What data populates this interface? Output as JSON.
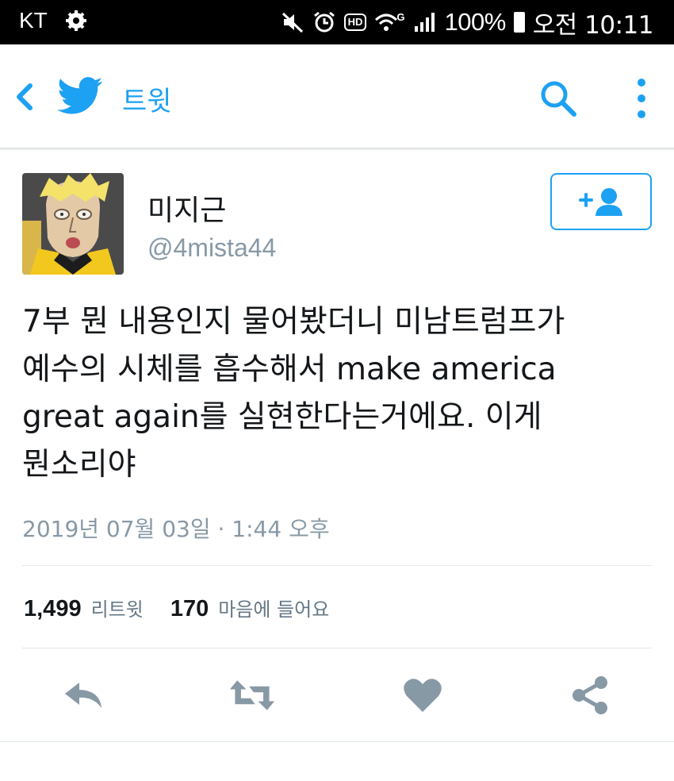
{
  "status_bar": {
    "carrier": "KT",
    "hd_label": "HD",
    "network_label": "G",
    "battery_percent": "100%",
    "time": "오전 10:11",
    "icons": [
      "gear-icon",
      "mute-icon",
      "alarm-icon",
      "wifi-icon",
      "signal-icon",
      "battery-icon"
    ]
  },
  "app_bar": {
    "title": "트윗",
    "icons": [
      "back-icon",
      "twitter-bird-icon",
      "search-icon",
      "more-vertical-icon"
    ]
  },
  "tweet": {
    "author": {
      "display_name": "미지근",
      "handle": "@4mista44"
    },
    "text": "7부 뭔 내용인지 물어봤더니 미남트럼프가\n예수의 시체를 흡수해서 make america\ngreat again를 실현한다는거에요. 이게\n뭔소리야",
    "timestamp": "2019년 07월 03일 · 1:44 오후",
    "retweets": {
      "count": "1,499",
      "label": "리트윗"
    },
    "likes": {
      "count": "170",
      "label": "마음에 들어요"
    }
  },
  "actions": [
    "reply-icon",
    "retweet-icon",
    "like-icon",
    "share-icon"
  ],
  "colors": {
    "accent": "#1da1f2",
    "action_icon": "#8899a6",
    "secondary_text": "#8899a6",
    "status_bar_bg": "#000000"
  }
}
